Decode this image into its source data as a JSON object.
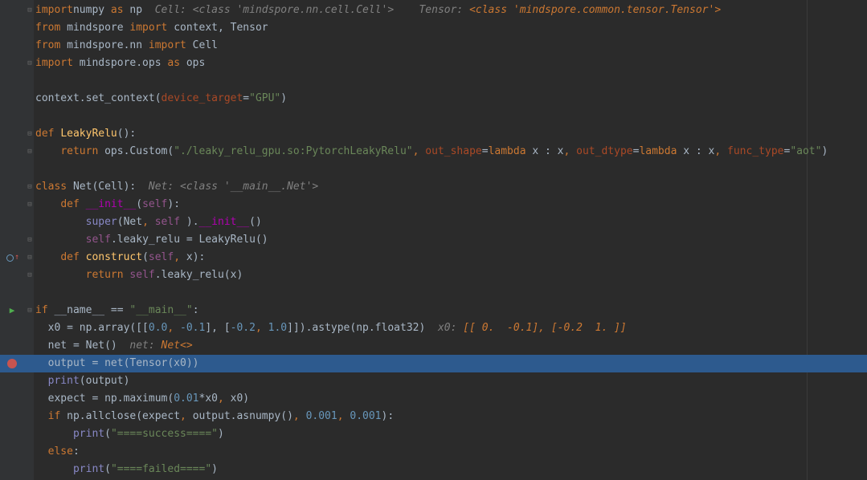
{
  "editor": {
    "lines": [
      {
        "segments": [
          [
            "kw",
            "import"
          ],
          [
            "",
            "numpy"
          ],
          [
            "kw",
            " as"
          ],
          [
            "",
            " np"
          ]
        ],
        "hint": [
          [
            "hint",
            "Cell: <class 'mindspore.nn.cell.Cell'>"
          ],
          [
            "hint",
            "    Tensor: "
          ],
          [
            "hint-val",
            "<class 'mindspore.common.tensor.Tensor'>"
          ]
        ]
      },
      {
        "segments": [
          [
            "kw",
            "from"
          ],
          [
            "",
            " mindspore "
          ],
          [
            "kw",
            "import"
          ],
          [
            "",
            " context, Tensor"
          ]
        ]
      },
      {
        "segments": [
          [
            "kw",
            "from"
          ],
          [
            "",
            " mindspore.nn "
          ],
          [
            "kw",
            "import"
          ],
          [
            "",
            " Cell"
          ]
        ]
      },
      {
        "segments": [
          [
            "kw",
            "import"
          ],
          [
            "",
            " mindspore.ops "
          ],
          [
            "kw",
            "as"
          ],
          [
            "",
            " ops"
          ]
        ]
      },
      {
        "segments": []
      },
      {
        "segments": [
          [
            "",
            "context.set_context("
          ],
          [
            "param",
            "device_target"
          ],
          [
            "",
            "="
          ],
          [
            "str",
            "\"GPU\""
          ],
          [
            "",
            ")"
          ]
        ]
      },
      {
        "segments": []
      },
      {
        "segments": [
          [
            "kw",
            "def "
          ],
          [
            "fn",
            "LeakyRelu"
          ],
          [
            "",
            "():"
          ]
        ]
      },
      {
        "segments": [
          [
            "",
            "    "
          ],
          [
            "kw",
            "return"
          ],
          [
            "",
            " ops.Custom("
          ],
          [
            "str",
            "\"./leaky_relu_gpu.so:PytorchLeakyRelu\""
          ],
          [
            "kw",
            ", "
          ],
          [
            "param",
            "out_shape"
          ],
          [
            "",
            "="
          ],
          [
            "kw",
            "lambda"
          ],
          [
            "",
            " x : x"
          ],
          [
            "kw",
            ", "
          ],
          [
            "param",
            "out_dtype"
          ],
          [
            "",
            "="
          ],
          [
            "kw",
            "lambda"
          ],
          [
            "",
            " x : x"
          ],
          [
            "kw",
            ", "
          ],
          [
            "param",
            "func_type"
          ],
          [
            "",
            "="
          ],
          [
            "str",
            "\"aot\""
          ],
          [
            "",
            ")"
          ]
        ]
      },
      {
        "segments": []
      },
      {
        "segments": [
          [
            "kw",
            "class "
          ],
          [
            "",
            "Net(Cell):"
          ]
        ],
        "hint": [
          [
            "hint",
            "Net: <class '__main__.Net'>"
          ]
        ]
      },
      {
        "segments": [
          [
            "",
            "    "
          ],
          [
            "kw",
            "def "
          ],
          [
            "dunder",
            "__init__"
          ],
          [
            "",
            "("
          ],
          [
            "self",
            "self"
          ],
          [
            "",
            "):"
          ]
        ]
      },
      {
        "segments": [
          [
            "",
            "        "
          ],
          [
            "bi",
            "super"
          ],
          [
            "",
            "(Net"
          ],
          [
            "kw",
            ", "
          ],
          [
            "self",
            "self"
          ],
          [
            "",
            " )."
          ],
          [
            "dunder",
            "__init__"
          ],
          [
            "",
            "()"
          ]
        ]
      },
      {
        "segments": [
          [
            "",
            "        "
          ],
          [
            "self",
            "self"
          ],
          [
            "",
            ".leaky_relu = LeakyRelu()"
          ]
        ]
      },
      {
        "segments": [
          [
            "",
            "    "
          ],
          [
            "kw",
            "def "
          ],
          [
            "fn",
            "construct"
          ],
          [
            "",
            "("
          ],
          [
            "self",
            "self"
          ],
          [
            "kw",
            ", "
          ],
          [
            "",
            "x):"
          ]
        ]
      },
      {
        "segments": [
          [
            "",
            "        "
          ],
          [
            "kw",
            "return "
          ],
          [
            "self",
            "self"
          ],
          [
            "",
            ".leaky_relu(x)"
          ]
        ]
      },
      {
        "segments": []
      },
      {
        "segments": [
          [
            "kw",
            "if"
          ],
          [
            "",
            " __name__ == "
          ],
          [
            "str",
            "\"__main__\""
          ],
          [
            "",
            ":"
          ]
        ]
      },
      {
        "segments": [
          [
            "",
            "  x0 = np.array([["
          ],
          [
            "num",
            "0.0"
          ],
          [
            "kw",
            ", "
          ],
          [
            "num",
            "-0.1"
          ],
          [
            "",
            "], ["
          ],
          [
            "num",
            "-0.2"
          ],
          [
            "kw",
            ", "
          ],
          [
            "num",
            "1.0"
          ],
          [
            "",
            "]]).astype(np.float32)"
          ]
        ],
        "hint": [
          [
            "hint",
            "x0: "
          ],
          [
            "hint-val",
            "[[ 0.  -0.1], [-0.2  1. ]]"
          ]
        ]
      },
      {
        "segments": [
          [
            "",
            "  net = Net()"
          ]
        ],
        "hint": [
          [
            "hint",
            "net: "
          ],
          [
            "hint-val",
            "Net<>"
          ]
        ]
      },
      {
        "segments": [
          [
            "",
            "  output = net(Tensor(x0))"
          ]
        ]
      },
      {
        "segments": [
          [
            "",
            "  "
          ],
          [
            "bi",
            "print"
          ],
          [
            "",
            "(output)"
          ]
        ]
      },
      {
        "segments": [
          [
            "",
            "  expect = np.maximum("
          ],
          [
            "num",
            "0.01"
          ],
          [
            "",
            "*x0"
          ],
          [
            "kw",
            ", "
          ],
          [
            "",
            "x0)"
          ]
        ]
      },
      {
        "segments": [
          [
            "",
            "  "
          ],
          [
            "kw",
            "if"
          ],
          [
            "",
            " np.allclose(expect"
          ],
          [
            "kw",
            ", "
          ],
          [
            "",
            "output.asnumpy()"
          ],
          [
            "kw",
            ", "
          ],
          [
            "num",
            "0.001"
          ],
          [
            "kw",
            ", "
          ],
          [
            "num",
            "0.001"
          ],
          [
            "",
            "):"
          ]
        ]
      },
      {
        "segments": [
          [
            "",
            "      "
          ],
          [
            "bi",
            "print"
          ],
          [
            "",
            "("
          ],
          [
            "str",
            "\"====success====\""
          ],
          [
            "",
            ")"
          ]
        ]
      },
      {
        "segments": [
          [
            "",
            "  "
          ],
          [
            "kw",
            "else"
          ],
          [
            "",
            ":"
          ]
        ]
      },
      {
        "segments": [
          [
            "",
            "      "
          ],
          [
            "bi",
            "print"
          ],
          [
            "",
            "("
          ],
          [
            "str",
            "\"====failed====\""
          ],
          [
            "",
            ")"
          ]
        ]
      }
    ],
    "current_line": 20,
    "breakpoint_line": 20,
    "run_marker_line": 17,
    "override_marker_line": 14,
    "fold_open_lines": [
      0,
      7,
      10,
      11,
      14,
      17
    ],
    "fold_end_lines": [
      3,
      8,
      13,
      15
    ],
    "colors": {
      "background": "#2b2b2b",
      "gutter": "#313335",
      "current_line": "#2d5a8e",
      "keyword": "#cc7832",
      "string": "#6a8759",
      "number": "#6897bb",
      "breakpoint": "#c75450",
      "run_marker": "#4fae4f"
    },
    "icons": {
      "run": "run-arrow-icon",
      "breakpoint": "breakpoint-icon",
      "override": "override-method-icon",
      "fold": "fold-icon"
    }
  }
}
